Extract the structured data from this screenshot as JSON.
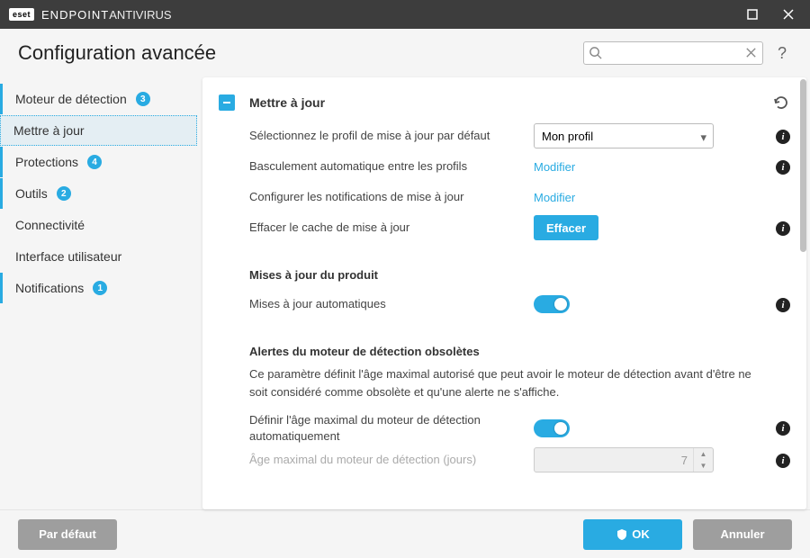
{
  "titlebar": {
    "brand": "eset",
    "product_strong": "ENDPOINT ",
    "product_light": "ANTIVIRUS"
  },
  "header": {
    "title": "Configuration avancée",
    "search_placeholder": ""
  },
  "sidebar": {
    "items": [
      {
        "label": "Moteur de détection",
        "badge": "3",
        "flag": true,
        "selected": false
      },
      {
        "label": "Mettre à jour",
        "badge": "",
        "flag": true,
        "selected": true
      },
      {
        "label": "Protections",
        "badge": "4",
        "flag": true,
        "selected": false
      },
      {
        "label": "Outils",
        "badge": "2",
        "flag": true,
        "selected": false
      },
      {
        "label": "Connectivité",
        "badge": "",
        "flag": false,
        "selected": false
      },
      {
        "label": "Interface utilisateur",
        "badge": "",
        "flag": false,
        "selected": false
      },
      {
        "label": "Notifications",
        "badge": "1",
        "flag": true,
        "selected": false
      }
    ]
  },
  "content": {
    "section_title": "Mettre à jour",
    "rows": {
      "profile_label": "Sélectionnez le profil de mise à jour par défaut",
      "profile_value": "Mon profil",
      "switch_label": "Basculement automatique entre les profils",
      "switch_link": "Modifier",
      "notify_label": "Configurer les notifications de mise à jour",
      "notify_link": "Modifier",
      "clear_label": "Effacer le cache de mise à jour",
      "clear_button": "Effacer"
    },
    "product_updates": {
      "heading": "Mises à jour du produit",
      "auto_label": "Mises à jour automatiques"
    },
    "engine_alerts": {
      "heading": "Alertes du moteur de détection obsolètes",
      "description": "Ce paramètre définit l'âge maximal autorisé que peut avoir le moteur de détection avant d'être ne soit considéré comme obsolète et qu'une alerte ne s'affiche.",
      "auto_age_label": "Définir l'âge maximal du moteur de détection automatiquement",
      "max_age_label": "Âge maximal du moteur de détection (jours)",
      "max_age_value": "7"
    }
  },
  "footer": {
    "default": "Par défaut",
    "ok": "OK",
    "cancel": "Annuler"
  }
}
